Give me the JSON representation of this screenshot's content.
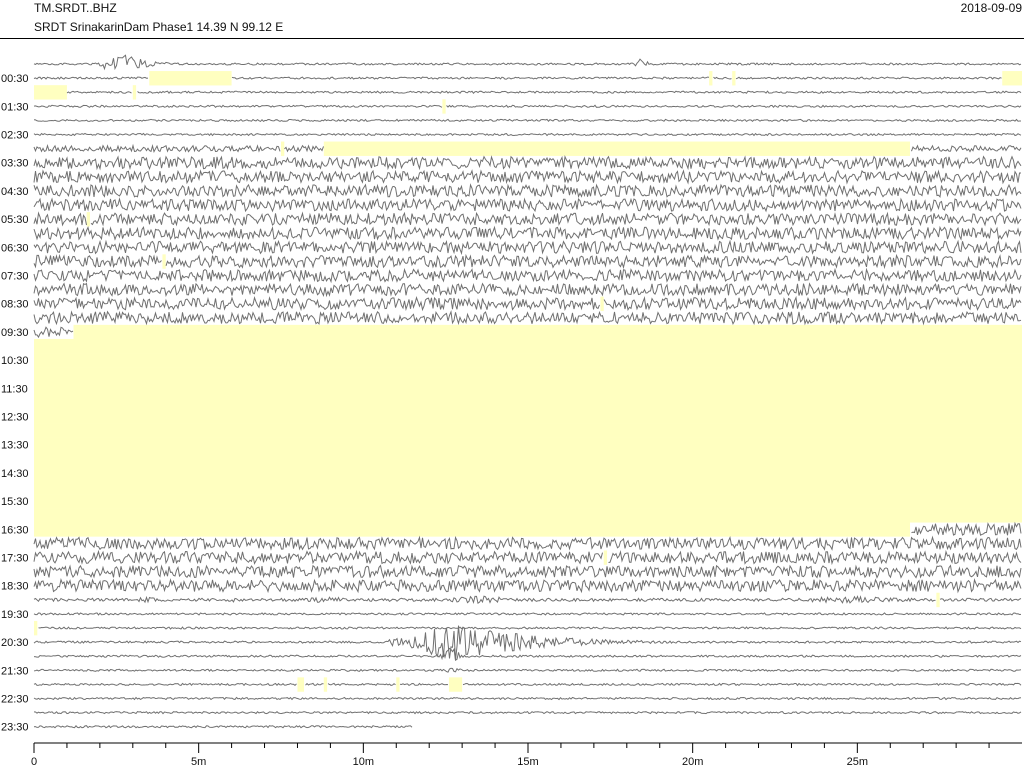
{
  "header": {
    "station_code": "TM.SRDT..BHZ",
    "station_desc": "SRDT SrinakarinDam Phase1  14.39 N 99.12 E",
    "date": "2018-09-09"
  },
  "colors": {
    "trace": "#707070",
    "gap": "#ffffc0",
    "axis": "#000000"
  },
  "chart_data": {
    "type": "helicorder",
    "xlabel": "",
    "ylabel": "",
    "x_unit": "minutes",
    "xlim": [
      0,
      30
    ],
    "x_tick_labels": [
      {
        "x": 0,
        "label": "0"
      },
      {
        "x": 5,
        "label": "5m"
      },
      {
        "x": 10,
        "label": "10m"
      },
      {
        "x": 15,
        "label": "15m"
      },
      {
        "x": 20,
        "label": "20m"
      },
      {
        "x": 25,
        "label": "25m"
      }
    ],
    "x_minor_tick_step": 1,
    "row_minutes": 30,
    "row_count": 48,
    "first_row_time": "00:00",
    "time_label_step_rows": 2,
    "row_labels": [
      "00:30",
      "01:30",
      "02:30",
      "03:30",
      "04:30",
      "05:30",
      "06:30",
      "07:30",
      "08:30",
      "09:30",
      "10:30",
      "11:30",
      "12:30",
      "13:30",
      "14:30",
      "15:30",
      "16:30",
      "17:30",
      "18:30",
      "19:30",
      "20:30",
      "21:30",
      "22:30",
      "23:30"
    ],
    "row_noise": [
      1,
      1,
      1,
      1,
      1,
      1,
      3,
      6,
      6,
      6,
      6,
      6,
      6,
      6,
      6,
      6,
      6,
      6,
      6,
      6,
      6,
      6,
      6,
      6,
      6,
      6,
      6,
      6,
      6,
      6,
      6,
      6,
      6,
      6,
      6,
      6,
      6,
      6,
      1.5,
      1,
      1,
      1,
      1,
      1,
      1,
      1,
      1,
      1
    ],
    "events": [
      {
        "row": 0,
        "start": 1.9,
        "peak": 2.5,
        "end": 4.6,
        "amp": 14
      },
      {
        "row": 0,
        "start": 18.2,
        "peak": 18.4,
        "end": 19.2,
        "amp": 6
      },
      {
        "row": 38,
        "start": 2.5,
        "peak": 3.5,
        "end": 4.8,
        "amp": 3
      },
      {
        "row": 38,
        "start": 5.5,
        "peak": 6.0,
        "end": 7.0,
        "amp": 3
      },
      {
        "row": 38,
        "start": 7.8,
        "peak": 9.0,
        "end": 10.5,
        "amp": 4
      },
      {
        "row": 38,
        "start": 12.0,
        "peak": 13.5,
        "end": 18.5,
        "amp": 4
      },
      {
        "row": 38,
        "start": 22.0,
        "peak": 25.0,
        "end": 29.8,
        "amp": 4
      },
      {
        "row": 37,
        "start": 25.0,
        "peak": 25.1,
        "end": 25.8,
        "amp": 6
      },
      {
        "row": 41,
        "start": 10.7,
        "peak": 12.7,
        "end": 19.5,
        "amp": 20
      },
      {
        "row": 41,
        "start": 10.7,
        "peak": 10.9,
        "end": 11.7,
        "amp": 6
      },
      {
        "row": 42,
        "start": 12.2,
        "peak": 12.7,
        "end": 13.4,
        "amp": 10
      },
      {
        "row": 43,
        "start": 12.4,
        "peak": 12.7,
        "end": 13.2,
        "amp": 6
      }
    ],
    "gaps": [
      {
        "row": 1,
        "start": 3.5,
        "end": 6.0
      },
      {
        "row": 1,
        "start": 20.5,
        "end": 20.6
      },
      {
        "row": 1,
        "start": 21.2,
        "end": 21.3
      },
      {
        "row": 1,
        "start": 29.4,
        "end": 30.0
      },
      {
        "row": 2,
        "start": 0.0,
        "end": 1.0
      },
      {
        "row": 2,
        "start": 3.0,
        "end": 3.1
      },
      {
        "row": 3,
        "start": 12.4,
        "end": 12.5
      },
      {
        "row": 6,
        "start": 7.5,
        "end": 7.6
      },
      {
        "row": 6,
        "start": 8.8,
        "end": 26.6
      },
      {
        "row": 11,
        "start": 1.6,
        "end": 1.7
      },
      {
        "row": 14,
        "start": 3.9,
        "end": 4.0
      },
      {
        "row": 17,
        "start": 17.2,
        "end": 17.3
      },
      {
        "row": 19,
        "start": 1.2,
        "end": 30.0
      },
      {
        "row": 20,
        "start": 0.0,
        "end": 30.0
      },
      {
        "row": 21,
        "start": 0.0,
        "end": 30.0
      },
      {
        "row": 22,
        "start": 0.0,
        "end": 30.0
      },
      {
        "row": 23,
        "start": 0.0,
        "end": 30.0
      },
      {
        "row": 24,
        "start": 0.0,
        "end": 30.0
      },
      {
        "row": 25,
        "start": 0.0,
        "end": 30.0
      },
      {
        "row": 26,
        "start": 0.0,
        "end": 30.0
      },
      {
        "row": 27,
        "start": 0.0,
        "end": 30.0
      },
      {
        "row": 28,
        "start": 0.0,
        "end": 30.0
      },
      {
        "row": 29,
        "start": 0.0,
        "end": 30.0
      },
      {
        "row": 30,
        "start": 0.0,
        "end": 30.0
      },
      {
        "row": 31,
        "start": 0.0,
        "end": 30.0
      },
      {
        "row": 32,
        "start": 0.0,
        "end": 30.0
      },
      {
        "row": 33,
        "start": 0.0,
        "end": 26.6
      },
      {
        "row": 35,
        "start": 17.3,
        "end": 17.4
      },
      {
        "row": 38,
        "start": 27.4,
        "end": 27.5
      },
      {
        "row": 40,
        "start": 0.0,
        "end": 0.1
      },
      {
        "row": 44,
        "start": 8.0,
        "end": 8.2
      },
      {
        "row": 44,
        "start": 8.8,
        "end": 8.9
      },
      {
        "row": 44,
        "start": 11.0,
        "end": 11.1
      },
      {
        "row": 44,
        "start": 12.6,
        "end": 13.0
      }
    ],
    "last_row_end": 11.5
  }
}
